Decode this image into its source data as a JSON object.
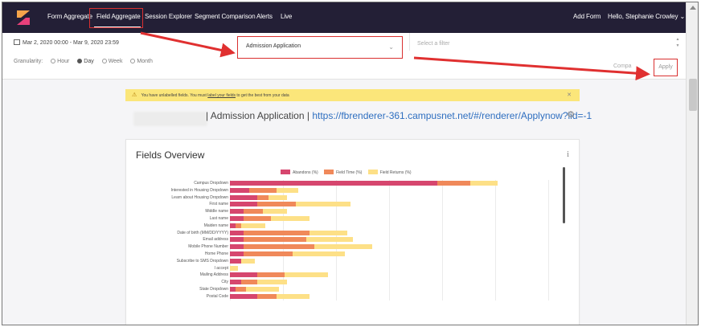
{
  "nav": {
    "items": [
      "Form Aggregate",
      "Field Aggregate",
      "Session Explorer",
      "Segment Comparison",
      "Alerts",
      "Live"
    ],
    "active": "Field Aggregate",
    "add_form": "Add Form",
    "user": "Hello, Stephanie Crowley"
  },
  "filters": {
    "date_range": "Mar 2, 2020 00:00 - Mar 9, 2020 23:59",
    "form_selected": "Admission Application",
    "filter_placeholder": "Select a filter",
    "granularity_label": "Granularity:",
    "granularity_options": [
      "Hour",
      "Day",
      "Week",
      "Month"
    ],
    "granularity_selected": "Day",
    "compare_label": "Compa",
    "apply_label": "Apply"
  },
  "notice": {
    "text_before": "You have unlabelled fields. You must ",
    "link": "label your fields",
    "text_after": " to get the best from your data"
  },
  "header": {
    "title_sep": "| Admission Application |",
    "url": "https://fbrenderer-361.campusnet.net/#/renderer/Applynow?lid=-1"
  },
  "card": {
    "title": "Fields Overview"
  },
  "chart_data": {
    "type": "bar",
    "stacked": true,
    "orientation": "horizontal",
    "legend": [
      "Abandons (%)",
      "Field Time (%)",
      "Field Returns (%)"
    ],
    "colors": [
      "#d6466e",
      "#f0895a",
      "#fde087"
    ],
    "categories": [
      "Campus Dropdown",
      "Interested in Housing Dropdown",
      "Learn about Housing Dropdown",
      "First name",
      "Middle name",
      "Last name",
      "Maiden name",
      "Date of birth (MM/DD/YYYY)",
      "Email address",
      "Mobile Phone Number",
      "Home Phone",
      "Subscribe to SMS Dropdown",
      "I accept",
      "Mailing Address",
      "City",
      "State Dropdown",
      "Postal Code"
    ],
    "series": [
      {
        "name": "Abandons (%)",
        "values": [
          76,
          7,
          10,
          10,
          5,
          5,
          2,
          5,
          5,
          5,
          5,
          4,
          0,
          10,
          4,
          2,
          10
        ]
      },
      {
        "name": "Field Time (%)",
        "values": [
          12,
          10,
          4,
          14,
          7,
          10,
          2,
          24,
          23,
          26,
          18,
          0,
          0,
          10,
          6,
          4,
          7
        ]
      },
      {
        "name": "Field Returns (%)",
        "values": [
          10,
          8,
          7,
          20,
          9,
          14,
          9,
          14,
          17,
          21,
          19,
          5,
          3,
          16,
          11,
          12,
          12
        ]
      }
    ]
  }
}
